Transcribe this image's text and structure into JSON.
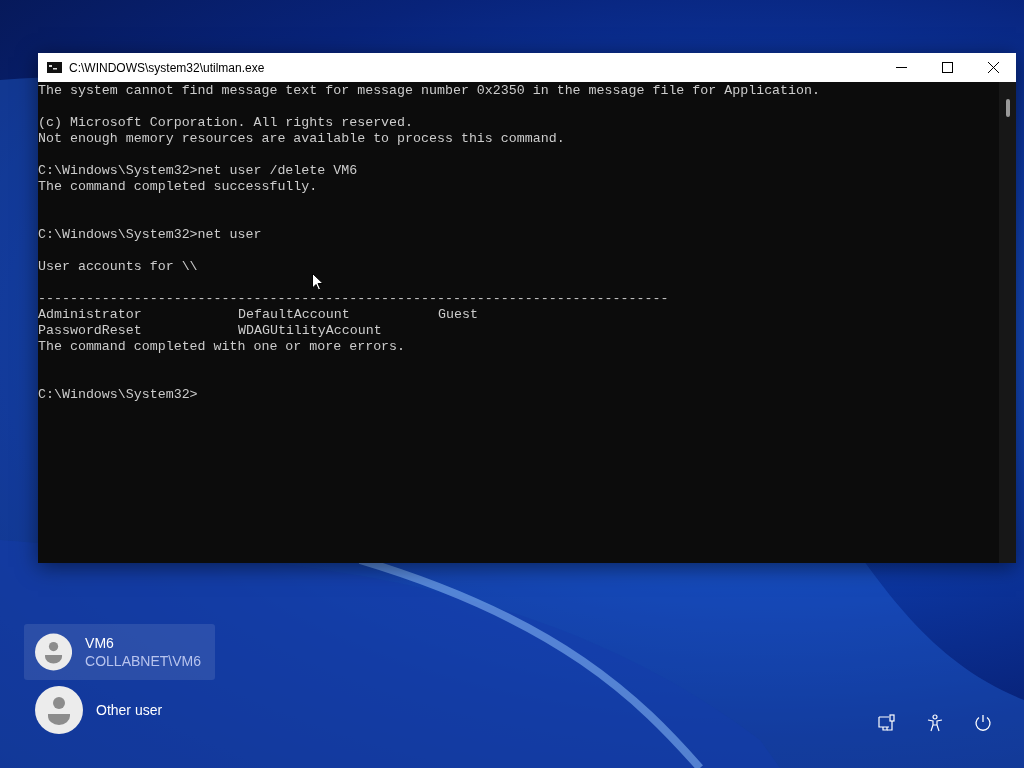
{
  "window": {
    "title": "C:\\WINDOWS\\system32\\utilman.exe"
  },
  "console": {
    "lines": [
      {
        "kind": "text",
        "text": "The system cannot find message text for message number 0x2350 in the message file for Application."
      },
      {
        "kind": "blank"
      },
      {
        "kind": "text",
        "text": "(c) Microsoft Corporation. All rights reserved."
      },
      {
        "kind": "text",
        "text": "Not enough memory resources are available to process this command."
      },
      {
        "kind": "blank"
      },
      {
        "kind": "text",
        "text": "C:\\Windows\\System32>net user /delete VM6"
      },
      {
        "kind": "text",
        "text": "The command completed successfully."
      },
      {
        "kind": "blank"
      },
      {
        "kind": "blank"
      },
      {
        "kind": "text",
        "text": "C:\\Windows\\System32>net user"
      },
      {
        "kind": "blank"
      },
      {
        "kind": "text",
        "text": "User accounts for \\\\"
      },
      {
        "kind": "blank"
      },
      {
        "kind": "text",
        "text": "-------------------------------------------------------------------------------"
      },
      {
        "kind": "columns",
        "cells": [
          "Administrator",
          "DefaultAccount",
          "Guest"
        ]
      },
      {
        "kind": "columns",
        "cells": [
          "PasswordReset",
          "WDAGUtilityAccount"
        ]
      },
      {
        "kind": "text",
        "text": "The command completed with one or more errors."
      },
      {
        "kind": "blank"
      },
      {
        "kind": "blank"
      },
      {
        "kind": "text",
        "text": "C:\\Windows\\System32>"
      }
    ]
  },
  "users": [
    {
      "name": "VM6",
      "account": "COLLABNET\\VM6",
      "selected": true
    },
    {
      "name": "Other user",
      "selected": false
    }
  ]
}
